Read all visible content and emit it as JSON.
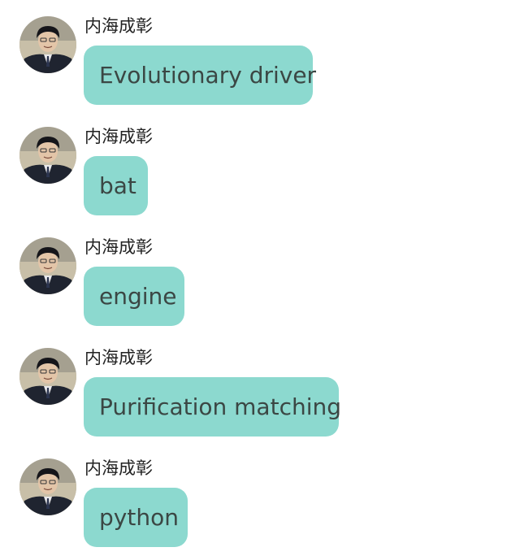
{
  "theme": {
    "bubble_color": "#8cd9cf",
    "bubble_text_color": "#3b4744",
    "sender_color": "#222222",
    "background": "#ffffff"
  },
  "messages": [
    {
      "sender": "内海成彰",
      "avatar_icon": "user-avatar-icon",
      "text": "Evolutionary driver"
    },
    {
      "sender": "内海成彰",
      "avatar_icon": "user-avatar-icon",
      "text": "bat"
    },
    {
      "sender": "内海成彰",
      "avatar_icon": "user-avatar-icon",
      "text": "engine"
    },
    {
      "sender": "内海成彰",
      "avatar_icon": "user-avatar-icon",
      "text": "Purification matching"
    },
    {
      "sender": "内海成彰",
      "avatar_icon": "user-avatar-icon",
      "text": "python"
    }
  ]
}
